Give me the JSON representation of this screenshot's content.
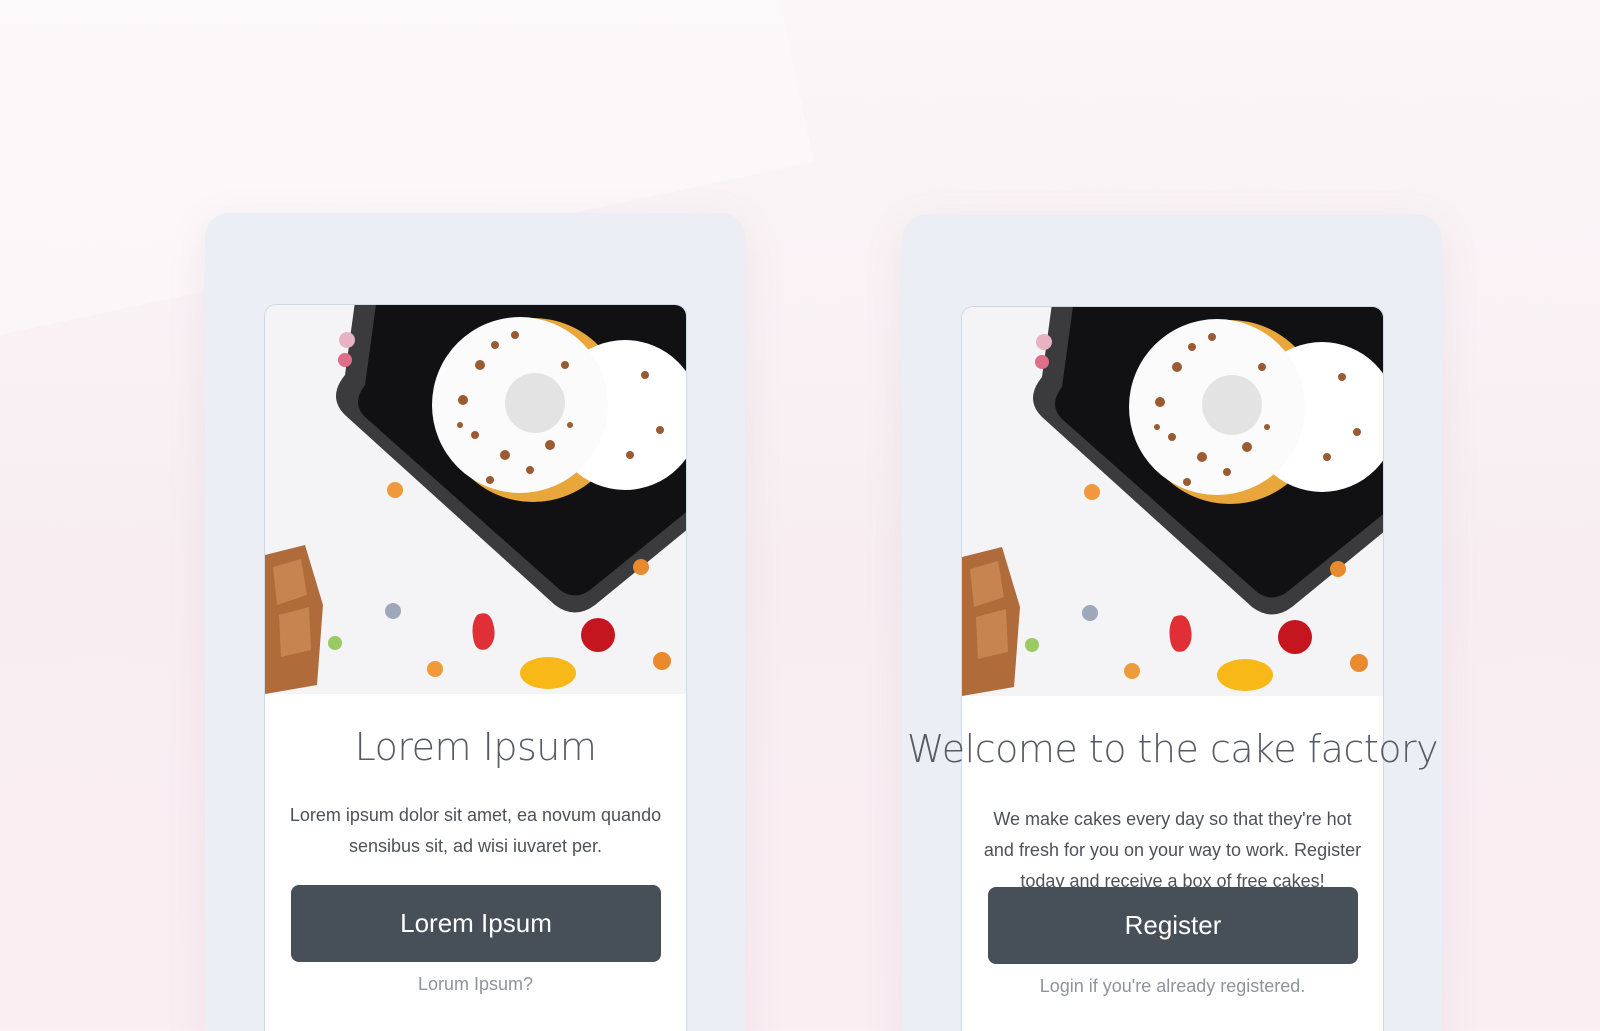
{
  "screens": [
    {
      "title": "Lorem Ipsum",
      "body": "Lorem ipsum dolor sit amet, ea novum quando sensibus sit, ad wisi iuvaret per.",
      "button_label": "Lorem Ipsum",
      "link_label": "Lorum Ipsum?"
    },
    {
      "title": "Welcome to the cake factory",
      "body": "We make cakes every day so that they're hot and fresh for you on your way to work. Register today and receive a box of free cakes!",
      "button_label": "Register",
      "link_label": "Login if you're already registered."
    }
  ],
  "colors": {
    "button": "#474f59",
    "phone_bg": "#ebeef4",
    "card_border": "#cfd9e6"
  }
}
